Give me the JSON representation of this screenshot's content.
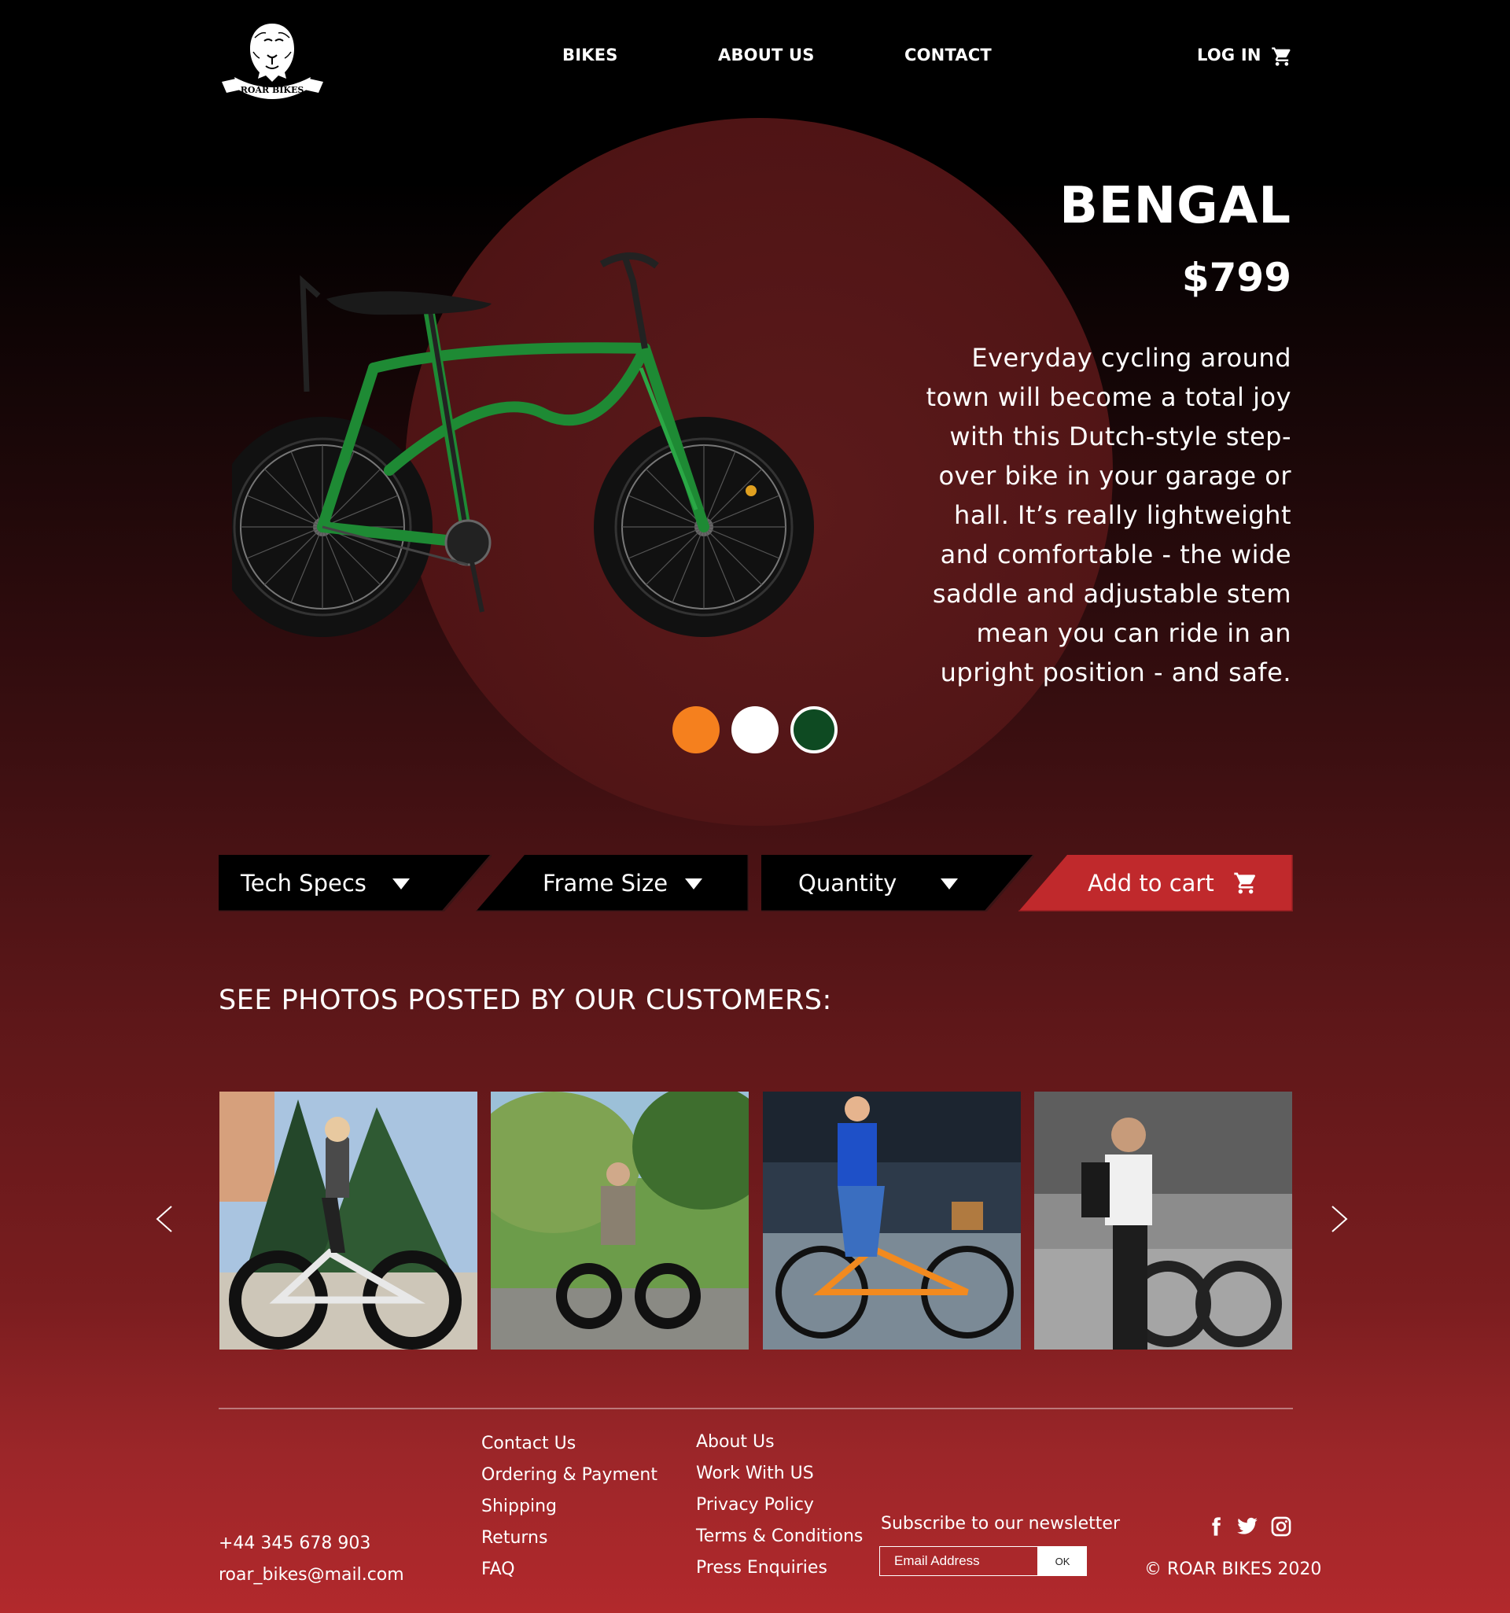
{
  "header": {
    "logo_text": "ROAR BIKES",
    "nav": [
      {
        "label": "BIKES"
      },
      {
        "label": "ABOUT US"
      },
      {
        "label": "CONTACT"
      }
    ],
    "login_label": "LOG IN",
    "cart_icon": "shopping-cart-icon"
  },
  "product": {
    "name": "BENGAL",
    "price": "$799",
    "description": "Everyday cycling around town will become a total joy with this Dutch-style step-over bike in your garage or hall. It’s really lightweight and comfortable - the wide saddle and adjustable stem mean you can ride in an upright position - and safe.",
    "colors": [
      "#f5801e",
      "#ffffff",
      "#0e4a22"
    ]
  },
  "controls": {
    "tech_specs": "Tech Specs",
    "frame_size": "Frame Size",
    "quantity": "Quantity",
    "add_to_cart": "Add to cart"
  },
  "customers": {
    "title": "SEE PHOTOS POSTED BY OUR CUSTOMERS:"
  },
  "footer": {
    "phone": "+44 345 678 903",
    "email": "roar_bikes@mail.com",
    "col1": [
      "Contact Us",
      "Ordering & Payment",
      "Shipping",
      "Returns",
      "FAQ"
    ],
    "col2": [
      "About Us",
      "Work With US",
      "Privacy Policy",
      "Terms & Conditions",
      "Press Enquiries"
    ],
    "newsletter_label": "Subscribe to our newsletter",
    "email_placeholder": "Email Address",
    "ok_label": "OK",
    "copyright": "© ROAR BIKES 2020"
  },
  "colors": {
    "accent_red": "#c0292c",
    "control_black": "#000000"
  }
}
